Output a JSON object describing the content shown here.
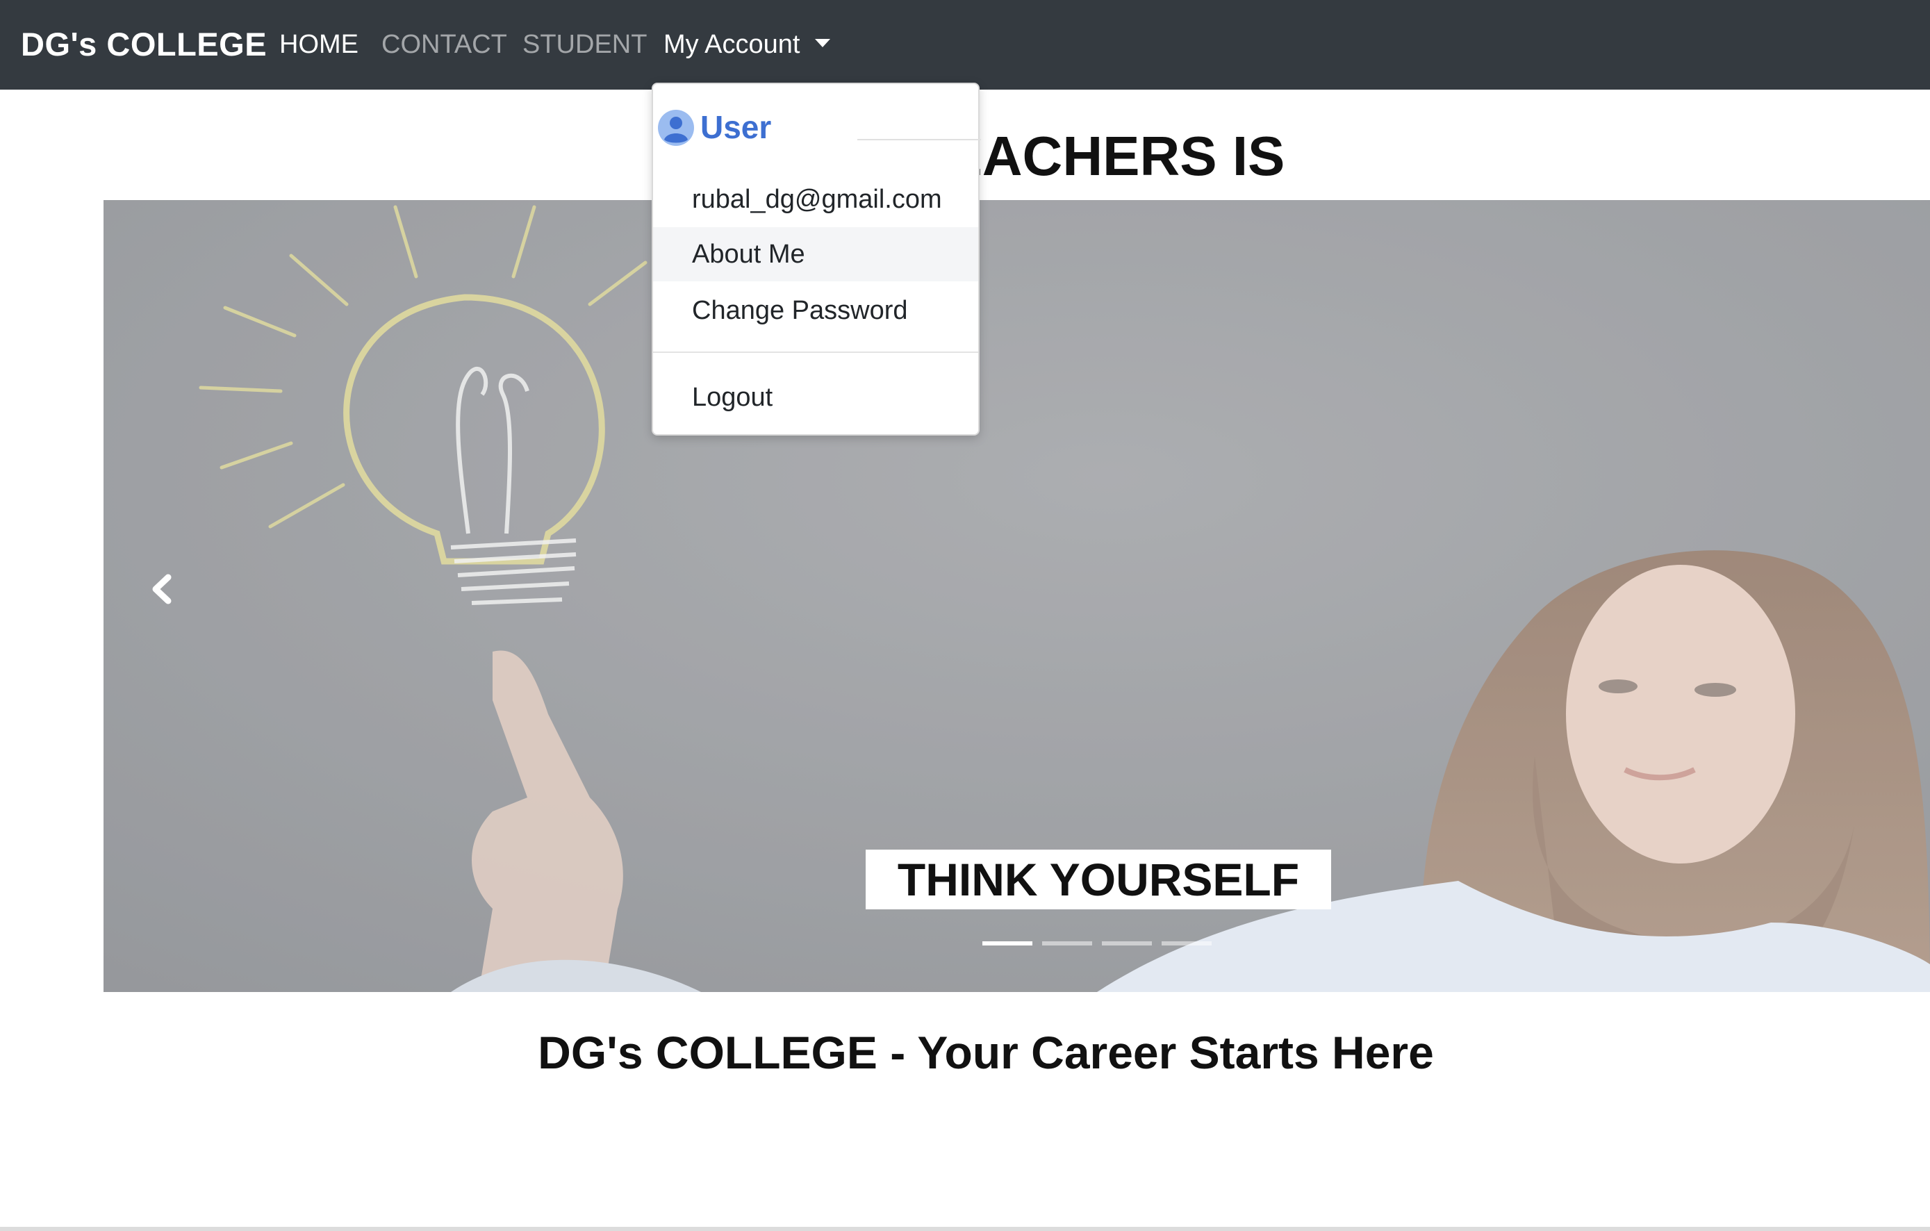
{
  "navbar": {
    "brand": "DG's COLLEGE",
    "links": [
      "HOME",
      "CONTACT",
      "STUDENT"
    ],
    "account_label": "My Account"
  },
  "top_heading": "TO FOR TEACHERS IS",
  "carousel": {
    "caption": "THINK YOURSELF",
    "slide_count": 4,
    "active_slide": 1
  },
  "dropdown": {
    "header": "User",
    "email": "rubal_dg@gmail.com",
    "items": [
      "About Me",
      "Change Password"
    ],
    "logout": "Logout"
  },
  "tagline": "DG's COLLEGE - Your Career Starts Here",
  "colors": {
    "navbar": "#343a40",
    "user_accent": "#3d6fd1"
  },
  "icons": {
    "user": "user-circle-icon",
    "prev": "chevron-left-icon",
    "caret": "caret-down-icon"
  }
}
